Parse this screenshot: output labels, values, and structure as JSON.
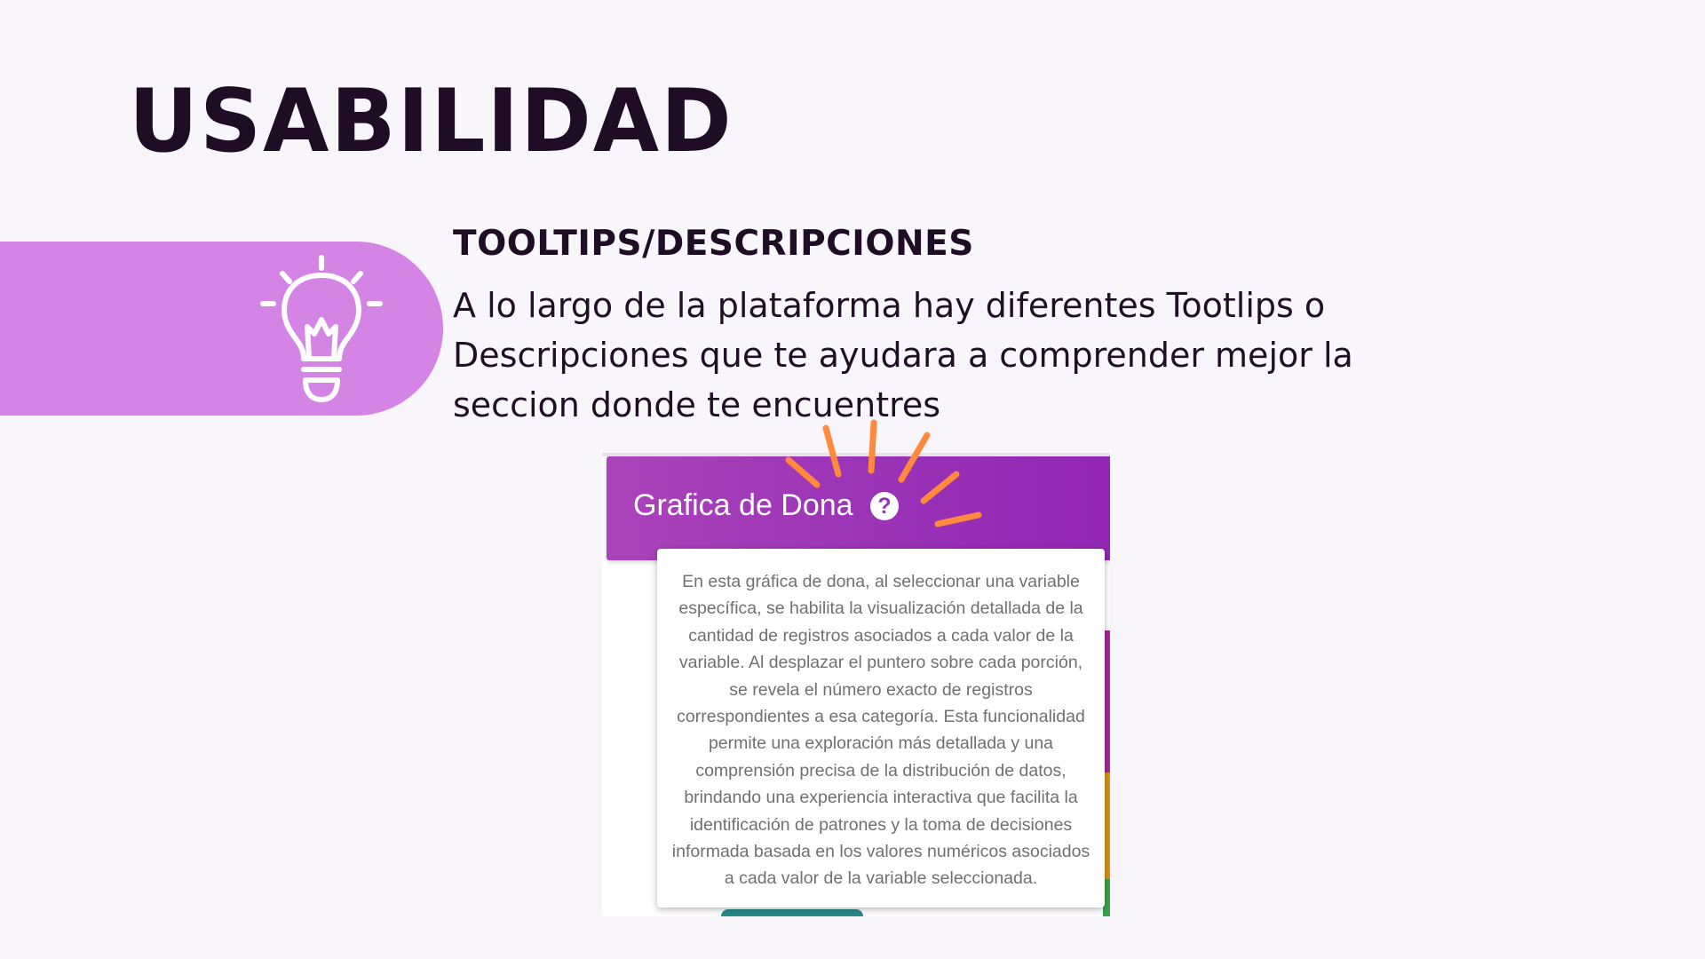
{
  "title": "USABILIDAD",
  "section": {
    "icon": "lightbulb-icon",
    "heading": "TOOLTIPS/DESCRIPCIONES",
    "body": "A lo largo de la plataforma hay diferentes Tootlips o Descripciones que te ayudara a comprender mejor la seccion donde te encuentres"
  },
  "screenshot": {
    "widget_title": "Grafica de Dona",
    "help_icon": "question-circle-icon",
    "help_glyph": "?",
    "tooltip_text": "En esta gráfica de dona, al seleccionar una variable específica, se habilita la visualización detallada de la cantidad de registros asociados a cada valor de la variable. Al desplazar el puntero sobre cada porción, se revela el número exacto de registros correspondientes a esa categoría. Esta funcionalidad permite una exploración más detallada y una comprensión precisa de la distribución de datos, brindando una experiencia interactiva que facilita la identificación de patrones y la toma de decisiones informada basada en los valores numéricos asociados a cada valor de la variable seleccionada."
  },
  "colors": {
    "background": "#f9f6fb",
    "title_text": "#1e0d24",
    "banner": "#d384e5",
    "header_purple": "#9a33b6",
    "tooltip_text": "#707070",
    "sparkle": "#ff8a3d"
  }
}
